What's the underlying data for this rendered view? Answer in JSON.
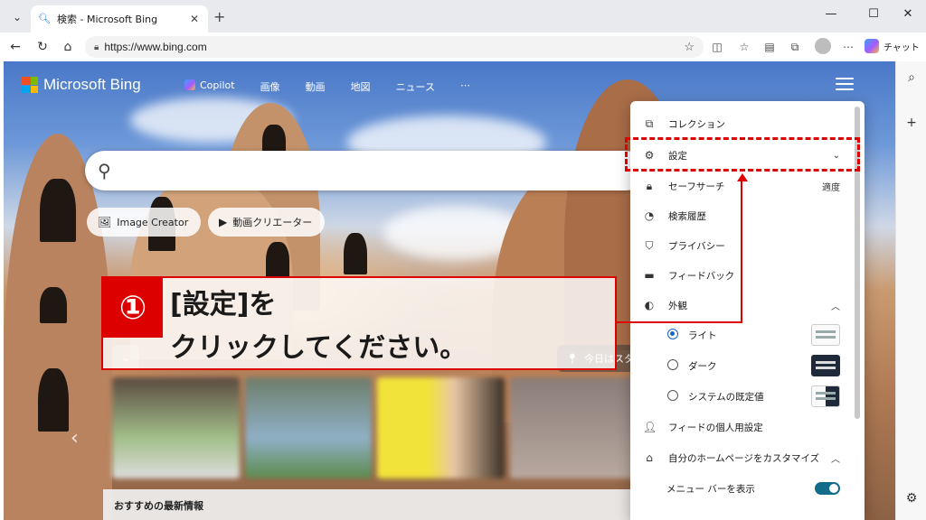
{
  "browser": {
    "tab_title": "検索 - Microsoft Bing",
    "url": "https://www.bing.com",
    "chat_label": "チャット"
  },
  "bing": {
    "logo_text": "Microsoft Bing",
    "nav": [
      "Copilot",
      "画像",
      "動画",
      "地図",
      "ニュース",
      "⋯"
    ],
    "image_creator_label": "Image Creator",
    "video_creator_label": "動画クリエーター",
    "news_heading": "おすすめの最新情報",
    "weather_text": "今日はスタ"
  },
  "menu": {
    "items": [
      {
        "label": "コレクション",
        "icon": "collections-icon"
      },
      {
        "label": "設定",
        "icon": "gear-icon"
      },
      {
        "label": "セーフサーチ",
        "icon": "lock-icon",
        "value": "適度"
      },
      {
        "label": "検索履歴",
        "icon": "clock-icon"
      },
      {
        "label": "プライバシー",
        "icon": "shield-icon"
      },
      {
        "label": "フィードバック",
        "icon": "feedback-icon"
      },
      {
        "label": "外観",
        "icon": "contrast-icon"
      },
      {
        "label": "ライト",
        "icon": "radio-on-icon"
      },
      {
        "label": "ダーク",
        "icon": "radio-off-icon"
      },
      {
        "label": "システムの既定値",
        "icon": "radio-off-icon"
      },
      {
        "label": "フィードの個人用設定",
        "icon": "person-icon"
      },
      {
        "label": "自分のホームページをカスタマイズ",
        "icon": "home-icon"
      },
      {
        "label": "メニュー バーを表示",
        "icon": "toggle-icon"
      }
    ]
  },
  "annotation": {
    "number": "①",
    "line1": "[設定]を",
    "line2": "クリックしてください。",
    "highlight_color": "#dd0000"
  }
}
